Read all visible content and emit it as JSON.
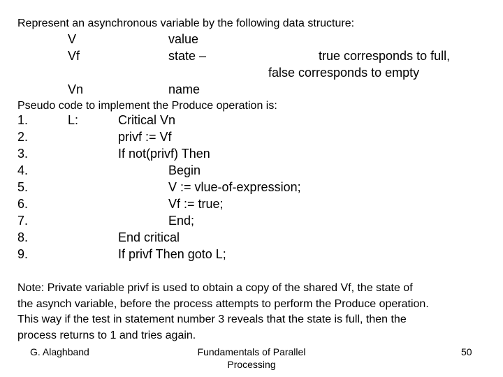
{
  "slide": {
    "intro": "Represent an asynchronous variable by the following data structure:",
    "structure": [
      {
        "field": "V",
        "description": "value"
      },
      {
        "field": "Vf",
        "description": "state  –",
        "detail_line1": "true corresponds to full,",
        "detail_line2": "false corresponds to empty"
      },
      {
        "field": "Vn",
        "description": "name"
      }
    ],
    "pseudo_heading": "Pseudo code to implement the Produce operation is:",
    "code_lines": [
      {
        "num": "1.",
        "label": "L:",
        "code": "Critical Vn"
      },
      {
        "num": "2.",
        "label": "",
        "code": "privf := Vf"
      },
      {
        "num": "3.",
        "label": "",
        "code": "If not(privf)  Then"
      },
      {
        "num": "4.",
        "label": "",
        "code": "Begin"
      },
      {
        "num": "5.",
        "label": "",
        "code": "V := vlue-of-expression;"
      },
      {
        "num": "6.",
        "label": "",
        "code": "Vf := true;"
      },
      {
        "num": "7.",
        "label": "",
        "code": "End;"
      },
      {
        "num": "8.",
        "label": "",
        "code": "End critical"
      },
      {
        "num": "9.",
        "label": "",
        "code": "If privf  Then  goto L;"
      }
    ],
    "note_lines": [
      "Note: Private variable privf is used to obtain a copy of the shared Vf, the state of",
      "the asynch variable, before the process attempts to perform the Produce operation.",
      "This way if the test in statement number 3 reveals that the state is full, then the",
      "process returns to 1 and tries again."
    ]
  },
  "footer": {
    "author": "G. Alaghband",
    "title_line1": "Fundamentals of Parallel",
    "title_line2": "Processing",
    "page_number": "50"
  }
}
